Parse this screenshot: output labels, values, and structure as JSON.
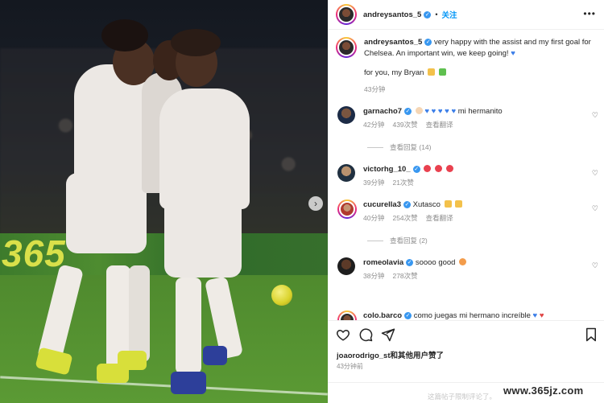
{
  "post": {
    "author": "andreysantos_5",
    "follow_label": "关注",
    "caption_line1": "very happy with the assist and my first goal for Chelsea. An important win, we keep going!",
    "caption_line2": "for you, my Bryan",
    "caption_time": "43分钟",
    "board_text": "365"
  },
  "comments": [
    {
      "user": "garnacho7",
      "text": "mi hermanito",
      "time": "42分钟",
      "likes": "439次赞",
      "reply": "查看翻译",
      "more": "查看回复 (14)"
    },
    {
      "user": "victorhg_10_",
      "text": "",
      "time": "39分钟",
      "likes": "21次赞",
      "reply": "",
      "more": ""
    },
    {
      "user": "cucurella3",
      "text": "Xutasco",
      "time": "40分钟",
      "likes": "254次赞",
      "reply": "查看翻译",
      "more": "查看回复 (2)"
    },
    {
      "user": "romeolavia",
      "text": "soooo good",
      "time": "38分钟",
      "likes": "278次赞",
      "reply": "",
      "more": ""
    },
    {
      "user": "colo.barco",
      "text": "como juegas mi hermano increíble",
      "time": "",
      "likes": "",
      "reply": "",
      "more": ""
    }
  ],
  "footer": {
    "liked_by": "joaorodrigo_st和其他用户赞了",
    "post_time": "43分钟前",
    "restricted": "这篇帖子限制评论了。",
    "watermark": "www.365jz.com"
  },
  "colors": {
    "verified": "#3897f0",
    "follow": "#0095f6",
    "muted": "#8e8e8e"
  },
  "icons": [
    "more-icon",
    "heart-icon",
    "comment-icon",
    "share-icon",
    "bookmark-icon",
    "chevron-right-icon"
  ]
}
